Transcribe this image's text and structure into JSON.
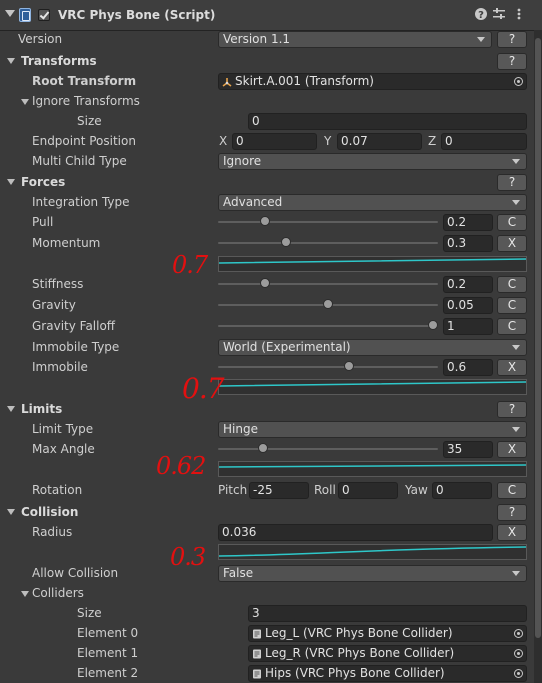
{
  "component": {
    "title": "VRC Phys Bone (Script)",
    "enabled": true
  },
  "help": "?",
  "version": {
    "label": "Version",
    "value": "Version 1.1"
  },
  "transforms": {
    "label": "Transforms",
    "root_transform": {
      "label": "Root Transform",
      "value": "Skirt.A.001 (Transform)"
    },
    "ignore_transforms": {
      "label": "Ignore Transforms",
      "size_label": "Size",
      "size": "0"
    },
    "endpoint_position": {
      "label": "Endpoint Position",
      "x_label": "X",
      "x": "0",
      "y_label": "Y",
      "y": "0.07",
      "z_label": "Z",
      "z": "0"
    },
    "multi_child_type": {
      "label": "Multi Child Type",
      "value": "Ignore"
    }
  },
  "forces": {
    "label": "Forces",
    "integration_type": {
      "label": "Integration Type",
      "value": "Advanced"
    },
    "pull": {
      "label": "Pull",
      "value": "0.2",
      "button": "C",
      "fraction": 0.2
    },
    "momentum": {
      "label": "Momentum",
      "value": "0.3",
      "button": "X",
      "fraction": 0.3
    },
    "stiffness": {
      "label": "Stiffness",
      "value": "0.2",
      "button": "C",
      "fraction": 0.2
    },
    "gravity": {
      "label": "Gravity",
      "value": "0.05",
      "button": "C",
      "fraction": 0.5
    },
    "gravity_falloff": {
      "label": "Gravity Falloff",
      "value": "1",
      "button": "C",
      "fraction": 1.0
    },
    "immobile_type": {
      "label": "Immobile Type",
      "value": "World (Experimental)"
    },
    "immobile": {
      "label": "Immobile",
      "value": "0.6",
      "button": "X",
      "fraction": 0.6
    }
  },
  "limits": {
    "label": "Limits",
    "limit_type": {
      "label": "Limit Type",
      "value": "Hinge"
    },
    "max_angle": {
      "label": "Max Angle",
      "value": "35",
      "button": "X",
      "fraction": 0.19
    },
    "rotation": {
      "label": "Rotation",
      "pitch_label": "Pitch",
      "pitch": "-25",
      "roll_label": "Roll",
      "roll": "0",
      "yaw_label": "Yaw",
      "yaw": "0",
      "button": "C"
    }
  },
  "collision": {
    "label": "Collision",
    "radius": {
      "label": "Radius",
      "value": "0.036",
      "button": "X"
    },
    "allow_collision": {
      "label": "Allow Collision",
      "value": "False"
    },
    "colliders": {
      "label": "Colliders",
      "size_label": "Size",
      "size": "3",
      "elements": [
        {
          "label": "Element 0",
          "value": "Leg_L (VRC Phys Bone Collider)"
        },
        {
          "label": "Element 1",
          "value": "Leg_R (VRC Phys Bone Collider)"
        },
        {
          "label": "Element 2",
          "value": "Hips (VRC Phys Bone Collider)"
        }
      ]
    }
  },
  "annotations": [
    "0.7",
    "0.7",
    "0.62",
    "0.3"
  ],
  "colors": {
    "curve": "#2ec7c9",
    "annotation": "#e21010"
  }
}
